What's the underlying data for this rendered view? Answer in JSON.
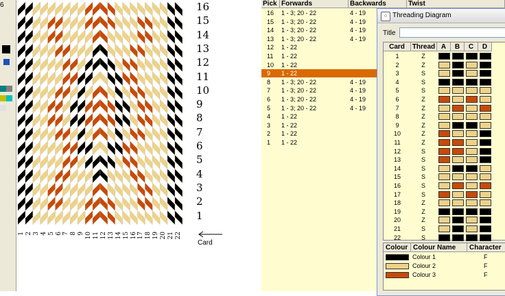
{
  "toolbar": {
    "label": "6",
    "swatches": [
      "#000000",
      "#2050c0",
      "#008080",
      "#808080",
      "#c0c000",
      "#00c0c0",
      "#e0e0e0"
    ]
  },
  "colors": {
    "colour1": "#000000",
    "colour2": "#edd28a",
    "colour3": "#c84a0a",
    "selected_row": "#d86a00"
  },
  "draft": {
    "pick_numbers": [
      "16",
      "15",
      "14",
      "13",
      "12",
      "11",
      "10",
      "9",
      "8",
      "7",
      "6",
      "5",
      "4",
      "3",
      "2",
      "1"
    ],
    "card_numbers": [
      "1",
      "2",
      "3",
      "4",
      "5",
      "6",
      "7",
      "8",
      "9",
      "10",
      "11",
      "12",
      "13",
      "14",
      "15",
      "16",
      "17",
      "18",
      "19",
      "20",
      "21",
      "22"
    ],
    "card_label": "Card",
    "grid": [
      [
        1,
        1,
        2,
        2,
        2,
        2,
        2,
        2,
        2,
        3,
        3,
        3,
        3,
        2,
        2,
        2,
        2,
        2,
        2,
        2,
        1,
        1
      ],
      [
        1,
        1,
        2,
        2,
        3,
        3,
        2,
        2,
        2,
        3,
        3,
        3,
        3,
        2,
        2,
        2,
        3,
        3,
        2,
        2,
        1,
        1
      ],
      [
        1,
        1,
        2,
        2,
        3,
        3,
        2,
        2,
        2,
        2,
        3,
        3,
        2,
        2,
        2,
        2,
        3,
        3,
        2,
        2,
        1,
        1
      ],
      [
        1,
        1,
        2,
        2,
        2,
        3,
        3,
        2,
        2,
        2,
        1,
        1,
        2,
        2,
        2,
        3,
        3,
        2,
        2,
        2,
        1,
        1
      ],
      [
        1,
        1,
        2,
        2,
        2,
        2,
        3,
        3,
        2,
        1,
        1,
        1,
        1,
        2,
        3,
        3,
        2,
        2,
        2,
        2,
        1,
        1
      ],
      [
        1,
        1,
        2,
        2,
        2,
        2,
        3,
        3,
        1,
        1,
        2,
        2,
        1,
        1,
        3,
        3,
        2,
        2,
        2,
        2,
        1,
        1
      ],
      [
        1,
        1,
        2,
        2,
        2,
        3,
        3,
        2,
        1,
        2,
        3,
        3,
        2,
        1,
        2,
        3,
        3,
        2,
        2,
        2,
        1,
        1
      ],
      [
        1,
        1,
        2,
        2,
        3,
        3,
        2,
        1,
        1,
        3,
        3,
        3,
        3,
        1,
        1,
        2,
        3,
        3,
        2,
        2,
        1,
        1
      ],
      [
        1,
        1,
        2,
        2,
        3,
        3,
        2,
        1,
        1,
        3,
        3,
        3,
        3,
        1,
        1,
        2,
        3,
        3,
        2,
        2,
        1,
        1
      ],
      [
        1,
        1,
        2,
        2,
        2,
        3,
        3,
        2,
        1,
        2,
        3,
        3,
        2,
        1,
        2,
        3,
        3,
        2,
        2,
        2,
        1,
        1
      ],
      [
        1,
        1,
        2,
        2,
        2,
        2,
        3,
        3,
        1,
        1,
        2,
        2,
        1,
        1,
        3,
        3,
        2,
        2,
        2,
        2,
        1,
        1
      ],
      [
        1,
        1,
        2,
        2,
        2,
        2,
        3,
        3,
        2,
        1,
        1,
        1,
        1,
        2,
        3,
        3,
        2,
        2,
        2,
        2,
        1,
        1
      ],
      [
        1,
        1,
        2,
        2,
        2,
        3,
        3,
        2,
        2,
        2,
        1,
        1,
        2,
        2,
        2,
        3,
        3,
        2,
        2,
        2,
        1,
        1
      ],
      [
        1,
        1,
        2,
        2,
        3,
        3,
        2,
        2,
        2,
        2,
        3,
        3,
        2,
        2,
        2,
        2,
        3,
        3,
        2,
        2,
        1,
        1
      ],
      [
        1,
        1,
        2,
        2,
        3,
        3,
        2,
        2,
        2,
        3,
        3,
        3,
        3,
        2,
        2,
        2,
        3,
        3,
        2,
        2,
        1,
        1
      ],
      [
        1,
        1,
        2,
        2,
        2,
        2,
        2,
        2,
        2,
        3,
        3,
        3,
        3,
        2,
        2,
        2,
        2,
        2,
        2,
        2,
        1,
        1
      ]
    ]
  },
  "pick_table": {
    "headers": [
      "Pick",
      "Forwards",
      "Backwards",
      "Twist"
    ],
    "rows": [
      {
        "pick": "16",
        "forwards": "1 - 3; 20 - 22",
        "backwards": "4 - 19"
      },
      {
        "pick": "15",
        "forwards": "1 - 3; 20 - 22",
        "backwards": "4 - 19"
      },
      {
        "pick": "14",
        "forwards": "1 - 3; 20 - 22",
        "backwards": "4 - 19"
      },
      {
        "pick": "13",
        "forwards": "1 - 3; 20 - 22",
        "backwards": "4 - 19"
      },
      {
        "pick": "12",
        "forwards": "1 - 22",
        "backwards": ""
      },
      {
        "pick": "11",
        "forwards": "1 - 22",
        "backwards": ""
      },
      {
        "pick": "10",
        "forwards": "1 - 22",
        "backwards": ""
      },
      {
        "pick": "9",
        "forwards": "1 - 22",
        "backwards": ""
      },
      {
        "pick": "8",
        "forwards": "1 - 3; 20 - 22",
        "backwards": "4 - 19"
      },
      {
        "pick": "7",
        "forwards": "1 - 3; 20 - 22",
        "backwards": "4 - 19"
      },
      {
        "pick": "6",
        "forwards": "1 - 3; 20 - 22",
        "backwards": "4 - 19"
      },
      {
        "pick": "5",
        "forwards": "1 - 3; 20 - 22",
        "backwards": "4 - 19"
      },
      {
        "pick": "4",
        "forwards": "1 - 22",
        "backwards": ""
      },
      {
        "pick": "3",
        "forwards": "1 - 22",
        "backwards": ""
      },
      {
        "pick": "2",
        "forwards": "1 - 22",
        "backwards": ""
      },
      {
        "pick": "1",
        "forwards": "1 - 22",
        "backwards": ""
      }
    ],
    "selected_pick": "9"
  },
  "threading": {
    "window_title": "Threading Diagram",
    "title_label": "Title",
    "title_value": "",
    "headers": [
      "Card",
      "Thread",
      "A",
      "B",
      "C",
      "D"
    ],
    "cards": [
      {
        "card": "1",
        "thread": "Z",
        "holes": [
          1,
          1,
          1,
          1
        ]
      },
      {
        "card": "2",
        "thread": "Z",
        "holes": [
          2,
          1,
          2,
          1
        ]
      },
      {
        "card": "3",
        "thread": "S",
        "holes": [
          2,
          1,
          2,
          1
        ]
      },
      {
        "card": "4",
        "thread": "S",
        "holes": [
          1,
          1,
          1,
          1
        ]
      },
      {
        "card": "5",
        "thread": "S",
        "holes": [
          2,
          2,
          2,
          2
        ]
      },
      {
        "card": "6",
        "thread": "Z",
        "holes": [
          3,
          2,
          3,
          2
        ]
      },
      {
        "card": "7",
        "thread": "Z",
        "holes": [
          2,
          3,
          2,
          3
        ]
      },
      {
        "card": "8",
        "thread": "Z",
        "holes": [
          2,
          2,
          2,
          2
        ]
      },
      {
        "card": "9",
        "thread": "Z",
        "holes": [
          2,
          1,
          1,
          2
        ]
      },
      {
        "card": "10",
        "thread": "Z",
        "holes": [
          3,
          2,
          2,
          1
        ]
      },
      {
        "card": "11",
        "thread": "Z",
        "holes": [
          3,
          3,
          2,
          1
        ]
      },
      {
        "card": "12",
        "thread": "S",
        "holes": [
          3,
          3,
          2,
          1
        ]
      },
      {
        "card": "13",
        "thread": "S",
        "holes": [
          3,
          2,
          2,
          1
        ]
      },
      {
        "card": "14",
        "thread": "S",
        "holes": [
          2,
          1,
          1,
          2
        ]
      },
      {
        "card": "15",
        "thread": "S",
        "holes": [
          2,
          2,
          2,
          2
        ]
      },
      {
        "card": "16",
        "thread": "S",
        "holes": [
          2,
          3,
          2,
          3
        ]
      },
      {
        "card": "17",
        "thread": "S",
        "holes": [
          3,
          2,
          3,
          2
        ]
      },
      {
        "card": "18",
        "thread": "Z",
        "holes": [
          2,
          2,
          2,
          2
        ]
      },
      {
        "card": "19",
        "thread": "Z",
        "holes": [
          1,
          1,
          1,
          1
        ]
      },
      {
        "card": "20",
        "thread": "Z",
        "holes": [
          2,
          1,
          2,
          1
        ]
      },
      {
        "card": "21",
        "thread": "S",
        "holes": [
          2,
          1,
          2,
          1
        ]
      },
      {
        "card": "22",
        "thread": "S",
        "holes": [
          1,
          1,
          1,
          1
        ]
      }
    ]
  },
  "colours": {
    "headers": [
      "Colour",
      "Colour Name",
      "Character"
    ],
    "rows": [
      {
        "name": "Colour 1",
        "character": "F",
        "color": "#000000"
      },
      {
        "name": "Colour 2",
        "character": "F",
        "color": "#edd28a"
      },
      {
        "name": "Colour 3",
        "character": "F",
        "color": "#c84a0a"
      }
    ]
  }
}
